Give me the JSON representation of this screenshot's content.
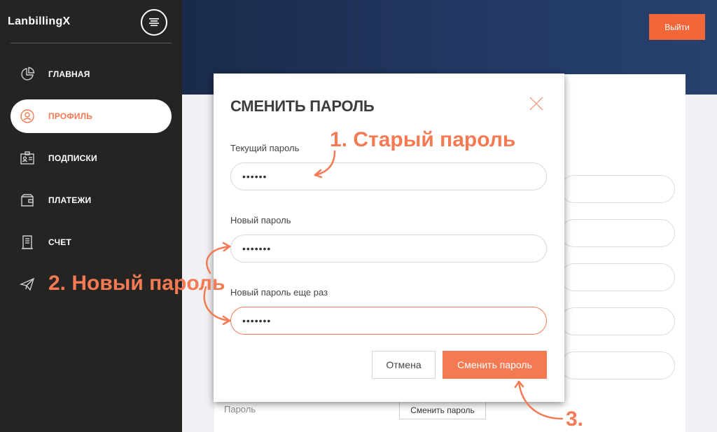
{
  "sidebar": {
    "brand": "LanbillingX",
    "items": [
      {
        "label": "ГЛАВНАЯ",
        "icon": "pie-chart-icon"
      },
      {
        "label": "ПРОФИЛЬ",
        "icon": "user-circle-icon"
      },
      {
        "label": "ПОДПИСКИ",
        "icon": "id-card-icon"
      },
      {
        "label": "ПЛАТЕЖИ",
        "icon": "wallet-icon"
      },
      {
        "label": "СЧЕТ",
        "icon": "document-icon"
      },
      {
        "label": "",
        "icon": "paper-plane-icon"
      }
    ]
  },
  "header": {
    "logout_label": "Выйти"
  },
  "background": {
    "password_label": "Пароль",
    "change_password_label": "Сменить пароль"
  },
  "modal": {
    "title": "СМЕНИТЬ ПАРОЛЬ",
    "current_label": "Текущий пароль",
    "current_value": "••••••",
    "new_label": "Новый пароль",
    "new_value": "•••••••",
    "repeat_label": "Новый пароль еще раз",
    "repeat_value": "•••••••",
    "cancel_label": "Отмена",
    "submit_label": "Сменить пароль"
  },
  "annotations": {
    "step1": "1. Старый пароль",
    "step2": "2. Новый пароль",
    "step3": "3."
  },
  "colors": {
    "accent": "#f47a53",
    "logout": "#f26637",
    "sidebar": "#262422",
    "header_dark": "#1a2a4a"
  }
}
